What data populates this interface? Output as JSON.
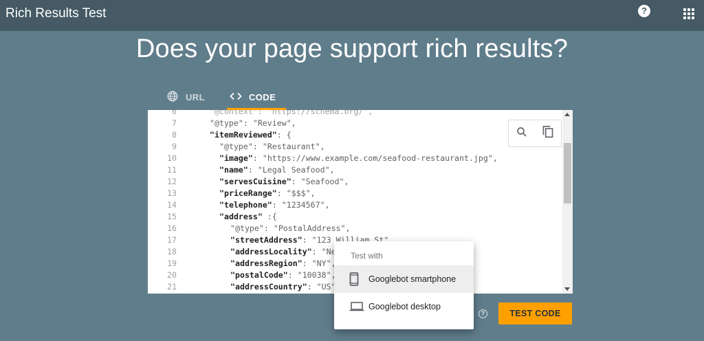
{
  "appbar": {
    "title": "Rich Results Test",
    "help_icon": "help-circle-icon",
    "apps_icon": "apps-grid-icon"
  },
  "headline": "Does your page support rich results?",
  "tabs": [
    {
      "label": "URL",
      "icon": "globe-icon",
      "active": false
    },
    {
      "label": "CODE",
      "icon": "code-brackets-icon",
      "active": true
    }
  ],
  "colors": {
    "appbar": "#455a64",
    "background": "#607d8b",
    "accent": "#ffa000"
  },
  "editor": {
    "lines": [
      {
        "n": "6",
        "tokens": [
          {
            "t": "\"@context\"",
            "c": "dim"
          },
          {
            "t": ": \"https://schema.org/\",",
            "c": "dim"
          }
        ],
        "indent": 46
      },
      {
        "n": "7",
        "tokens": [
          {
            "t": "\"@type\"",
            "c": ""
          },
          {
            "t": ": \"Review\",",
            "c": ""
          }
        ],
        "indent": 46
      },
      {
        "n": "8",
        "tokens": [
          {
            "t": "\"itemReviewed\"",
            "c": "k"
          },
          {
            "t": ": {",
            "c": ""
          }
        ],
        "indent": 46
      },
      {
        "n": "9",
        "tokens": [
          {
            "t": "\"@type\"",
            "c": ""
          },
          {
            "t": ": \"Restaurant\",",
            "c": ""
          }
        ],
        "indent": 60
      },
      {
        "n": "10",
        "tokens": [
          {
            "t": "\"image\"",
            "c": "k"
          },
          {
            "t": ": \"https://www.example.com/seafood-restaurant.jpg\",",
            "c": ""
          }
        ],
        "indent": 60
      },
      {
        "n": "11",
        "tokens": [
          {
            "t": "\"name\"",
            "c": "k"
          },
          {
            "t": ": \"Legal Seafood\",",
            "c": ""
          }
        ],
        "indent": 60
      },
      {
        "n": "12",
        "tokens": [
          {
            "t": "\"servesCuisine\"",
            "c": "k"
          },
          {
            "t": ": \"Seafood\",",
            "c": ""
          }
        ],
        "indent": 60
      },
      {
        "n": "13",
        "tokens": [
          {
            "t": "\"priceRange\"",
            "c": "k"
          },
          {
            "t": ": \"$$$\",",
            "c": ""
          }
        ],
        "indent": 60
      },
      {
        "n": "14",
        "tokens": [
          {
            "t": "\"telephone\"",
            "c": "k"
          },
          {
            "t": ": \"1234567\",",
            "c": ""
          }
        ],
        "indent": 60
      },
      {
        "n": "15",
        "tokens": [
          {
            "t": "\"address\"",
            "c": "k"
          },
          {
            "t": " :{",
            "c": ""
          }
        ],
        "indent": 60
      },
      {
        "n": "16",
        "tokens": [
          {
            "t": "\"@type\"",
            "c": ""
          },
          {
            "t": ": \"PostalAddress\",",
            "c": ""
          }
        ],
        "indent": 76
      },
      {
        "n": "17",
        "tokens": [
          {
            "t": "\"streetAddress\"",
            "c": "k"
          },
          {
            "t": ": \"123 William St\",",
            "c": ""
          }
        ],
        "indent": 76
      },
      {
        "n": "18",
        "tokens": [
          {
            "t": "\"addressLocality\"",
            "c": "k"
          },
          {
            "t": ": \"Ne",
            "c": ""
          }
        ],
        "indent": 76
      },
      {
        "n": "19",
        "tokens": [
          {
            "t": "\"addressRegion\"",
            "c": "k"
          },
          {
            "t": ": \"NY\",",
            "c": ""
          }
        ],
        "indent": 76
      },
      {
        "n": "20",
        "tokens": [
          {
            "t": "\"postalCode\"",
            "c": "k"
          },
          {
            "t": ": \"10038\",",
            "c": ""
          }
        ],
        "indent": 76
      },
      {
        "n": "21",
        "tokens": [
          {
            "t": "\"addressCountry\"",
            "c": "k"
          },
          {
            "t": ": \"US\"",
            "c": ""
          }
        ],
        "indent": 76
      }
    ],
    "search_icon": "search-icon",
    "copy_icon": "copy-icon"
  },
  "menu": {
    "header": "Test with",
    "items": [
      {
        "label": "Googlebot smartphone",
        "icon": "smartphone-icon",
        "selected": true
      },
      {
        "label": "Googlebot desktop",
        "icon": "laptop-icon",
        "selected": false
      }
    ]
  },
  "test_button": {
    "label": "TEST CODE"
  },
  "small_help": "?"
}
